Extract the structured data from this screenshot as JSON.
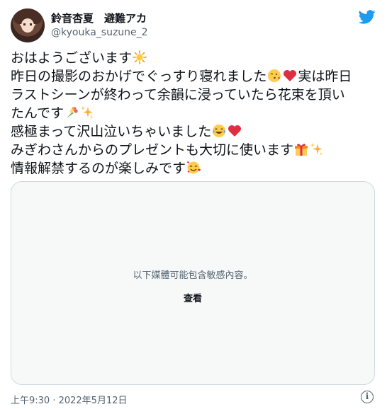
{
  "user": {
    "display_name": "鈴音杏夏　避難アカ",
    "handle": "@kyouka_suzune_2"
  },
  "tweet": {
    "lines": [
      {
        "text": "おはようございます",
        "emoji": [
          "sun-emoji"
        ]
      },
      {
        "text": "昨日の撮影のおかげでぐっすり寝れました",
        "emoji": [
          "kissing-face-emoji",
          "red-heart-emoji"
        ],
        "tail": "実は昨日"
      },
      {
        "text": "ラストシーンが終わって余韻に浸っていたら花束を頂い"
      },
      {
        "text": "たんです",
        "emoji": [
          "bouquet-emoji",
          "sparkles-emoji"
        ]
      },
      {
        "text": "感極まって沢山泣いちゃいました",
        "emoji": [
          "tears-of-joy-emoji",
          "red-heart-emoji"
        ]
      },
      {
        "text": "みぎわさんからのプレゼントも大切に使います",
        "emoji": [
          "gift-emoji",
          "sparkles-emoji"
        ]
      },
      {
        "text": "情報解禁するのが楽しみです",
        "emoji": [
          "smiling-face-with-hearts-emoji"
        ]
      }
    ]
  },
  "media": {
    "warning_text": "以下媒體可能包含敏感內容。",
    "view_label": "查看"
  },
  "meta": {
    "timestamp": "上午9:30 · 2022年5月12日"
  },
  "colors": {
    "twitter_blue": "#1d9bf0",
    "secondary_text": "#536471",
    "border": "#cfd9de"
  }
}
